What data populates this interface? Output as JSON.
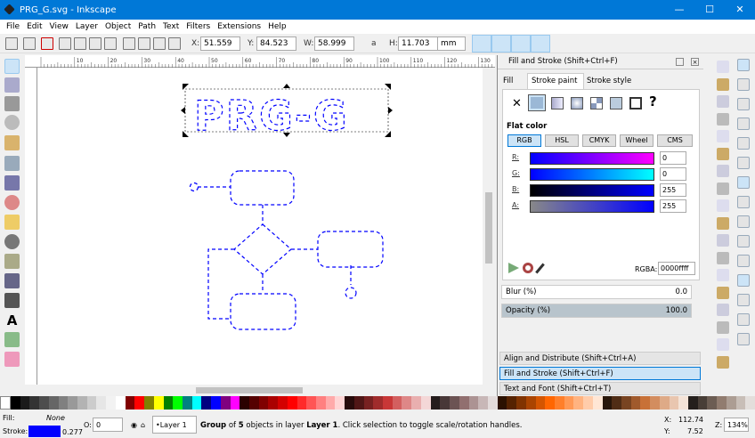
{
  "window": {
    "title": "PRG_G.svg - Inkscape",
    "minimize": "—",
    "maximize": "☐",
    "close": "✕"
  },
  "menu": [
    "File",
    "Edit",
    "View",
    "Layer",
    "Object",
    "Path",
    "Text",
    "Filters",
    "Extensions",
    "Help"
  ],
  "toolbar": {
    "x_label": "X:",
    "x": "51.559",
    "y_label": "Y:",
    "y": "84.523",
    "w_label": "W:",
    "w": "58.999",
    "h_label": "H:",
    "h": "11.703",
    "unit": "mm",
    "lock_glyph": "a"
  },
  "ruler": [
    "10",
    "20",
    "30",
    "40",
    "50",
    "60",
    "70",
    "80",
    "90",
    "100",
    "110",
    "120",
    "130"
  ],
  "canvas": {
    "text": "PRG-G",
    "stroke_color": "#0000ff"
  },
  "dialog": {
    "title": "Fill and Stroke (Shift+Ctrl+F)",
    "tabs": [
      "Fill",
      "Stroke paint",
      "Stroke style"
    ],
    "paint_types": [
      "✕",
      "flat",
      "linear",
      "radial",
      "pattern",
      "swatch",
      "unset",
      "?"
    ],
    "flat_color_label": "Flat color",
    "modes": [
      "RGB",
      "HSL",
      "CMYK",
      "Wheel",
      "CMS"
    ],
    "channels": [
      {
        "label": "R:",
        "value": "0"
      },
      {
        "label": "G:",
        "value": "0"
      },
      {
        "label": "B:",
        "value": "255"
      },
      {
        "label": "A:",
        "value": "255"
      }
    ],
    "rgba_label": "RGBA:",
    "rgba": "0000ffff",
    "blur_label": "Blur (%)",
    "blur": "0.0",
    "opacity_label": "Opacity (%)",
    "opacity": "100.0",
    "collapsed": [
      "Align and Distribute (Shift+Ctrl+A)",
      "Fill and Stroke (Shift+Ctrl+F)",
      "Text and Font (Shift+Ctrl+T)"
    ]
  },
  "palette": [
    "#000000",
    "#1a1a1a",
    "#333333",
    "#4d4d4d",
    "#666666",
    "#808080",
    "#999999",
    "#b3b3b3",
    "#cccccc",
    "#e6e6e6",
    "#f2f2f2",
    "#ffffff",
    "#800000",
    "#ff0000",
    "#808000",
    "#ffff00",
    "#008000",
    "#00ff00",
    "#008080",
    "#00ffff",
    "#000080",
    "#0000ff",
    "#800080",
    "#ff00ff",
    "#2b0000",
    "#550000",
    "#800000",
    "#aa0000",
    "#d40000",
    "#ff0000",
    "#ff2a2a",
    "#ff5555",
    "#ff8080",
    "#ffaaaa",
    "#ffd5d5",
    "#280b0b",
    "#501616",
    "#782121",
    "#a02c2c",
    "#c83737",
    "#d35f5f",
    "#de8787",
    "#e9afaf",
    "#f4d7d7",
    "#241c1c",
    "#483737",
    "#6c5353",
    "#916f6f",
    "#ac9393",
    "#c8b7b7",
    "#e3dbdb",
    "#2b1100",
    "#552200",
    "#803300",
    "#aa4400",
    "#d45500",
    "#ff6600",
    "#ff7f2a",
    "#ff9955",
    "#ffb380",
    "#ffccaa",
    "#ffe6d5",
    "#28170b",
    "#502d16",
    "#784421",
    "#a05a2c",
    "#c87137",
    "#d38d5f",
    "#deaa87",
    "#e9c6af",
    "#f4e3d7",
    "#241f1c",
    "#483e37",
    "#6c5d53",
    "#917c6f",
    "#ac9d93",
    "#c8beb7",
    "#e3dedb"
  ],
  "status": {
    "fill_label": "Fill:",
    "fill": "None",
    "stroke_label": "Stroke:",
    "stroke_width": "0.277",
    "stroke_color": "#0000ff",
    "o_label": "O:",
    "o": "0",
    "layer": "•Layer 1",
    "message_pre": "Group",
    "message_mid": " of ",
    "count": "5",
    "message_mid2": " objects in layer ",
    "layer_name": "Layer 1",
    "message_post": ". Click selection to toggle scale/rotation handles.",
    "x_label": "X:",
    "x": "112.74",
    "y_label": "Y:",
    "y": "7.52",
    "z_label": "Z:",
    "zoom": "134%"
  }
}
